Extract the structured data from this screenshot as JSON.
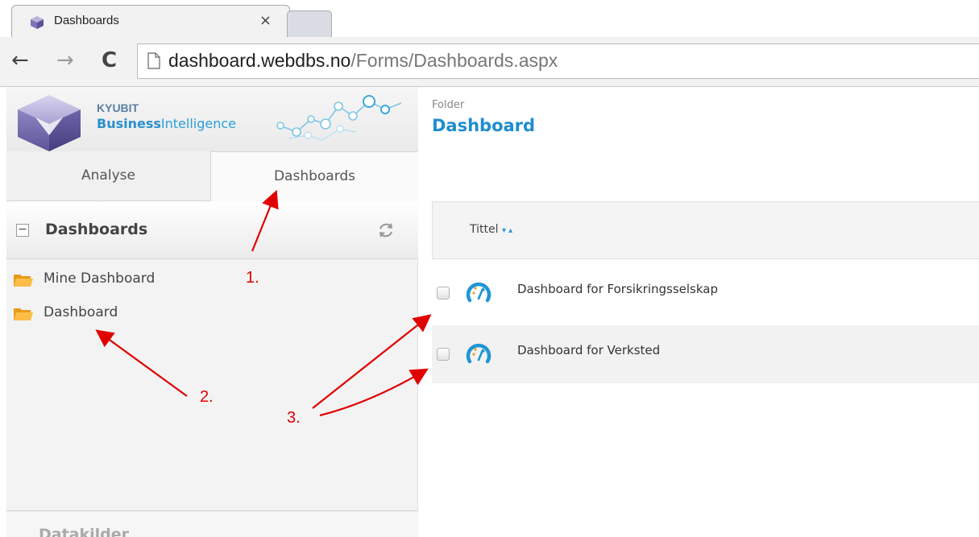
{
  "browser": {
    "tab_title": "Dashboards",
    "tab_close": "×",
    "url_host": "dashboard.webdbs.no",
    "url_path": "/Forms/Dashboards.aspx"
  },
  "brand": {
    "line1": "KYUBIT",
    "line2_bold": "Business",
    "line2_rest": "Intelligence"
  },
  "sidebar": {
    "tabs": [
      {
        "label": "Analyse",
        "active": false
      },
      {
        "label": "Dashboards",
        "active": true
      }
    ],
    "panel_toggle": "−",
    "panel_title": "Dashboards",
    "tree": [
      {
        "label": "Mine Dashboard"
      },
      {
        "label": "Dashboard"
      }
    ],
    "footer_partial": "Datakilder"
  },
  "main": {
    "folder_label": "Folder",
    "folder_title": "Dashboard",
    "column_title": "Tittel",
    "column_sort": "▾ ▴",
    "rows": [
      {
        "name": "Dashboard for Forsikringsselskap"
      },
      {
        "name": "Dashboard for Verksted"
      }
    ]
  },
  "annotations": {
    "labels": [
      "1.",
      "2.",
      "3."
    ],
    "color": "#e00000"
  },
  "colors": {
    "accent": "#1f8dd0",
    "folder": "#f5a623",
    "annotation": "#e00000"
  }
}
